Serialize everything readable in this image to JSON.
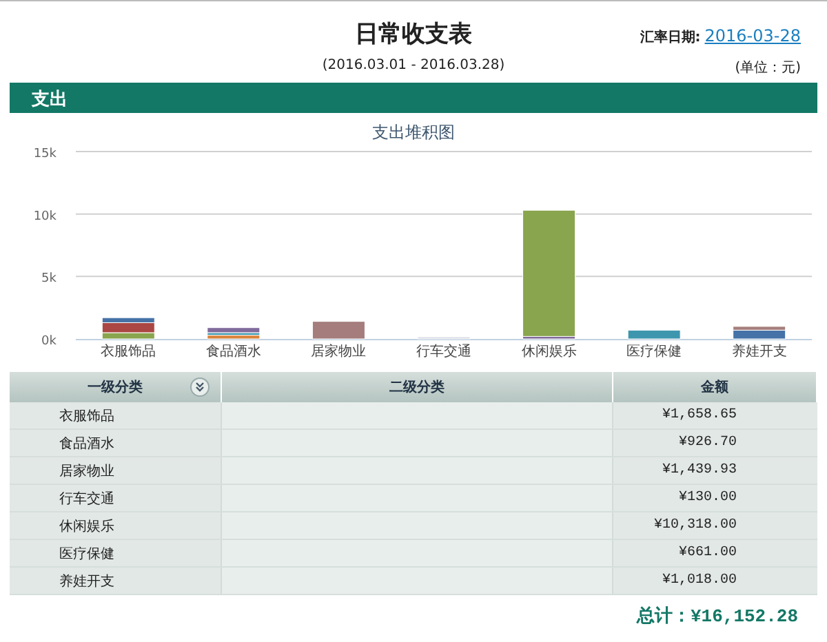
{
  "header": {
    "title": "日常收支表",
    "period": "(2016.03.01 - 2016.03.28)",
    "rate_label": "汇率日期:",
    "rate_date": "2016-03-28",
    "unit": "(单位：元)"
  },
  "section": {
    "title": "支出"
  },
  "chart_data": {
    "type": "bar",
    "stacked": true,
    "title": "支出堆积图",
    "categories": [
      "衣服饰品",
      "食品酒水",
      "居家物业",
      "行车交通",
      "休闲娱乐",
      "医疗保健",
      "养娃开支"
    ],
    "ylim": [
      0,
      15000
    ],
    "yticks": [
      {
        "value": 0,
        "label": "0k"
      },
      {
        "value": 5000,
        "label": "5k"
      },
      {
        "value": 10000,
        "label": "10k"
      },
      {
        "value": 15000,
        "label": "15k"
      }
    ],
    "series": [
      {
        "color": "#db843d",
        "values": [
          null,
          300,
          null,
          null,
          null,
          null,
          null
        ]
      },
      {
        "color": "#3d96ae",
        "values": [
          null,
          200,
          null,
          null,
          null,
          700,
          null
        ]
      },
      {
        "color": "#80699b",
        "values": [
          null,
          400,
          null,
          null,
          200,
          null,
          null
        ]
      },
      {
        "color": "#89a54e",
        "values": [
          500,
          null,
          null,
          null,
          10100,
          null,
          null
        ]
      },
      {
        "color": "#aa4643",
        "values": [
          800,
          null,
          null,
          null,
          null,
          null,
          null
        ]
      },
      {
        "color": "#4572a7",
        "values": [
          400,
          null,
          null,
          null,
          null,
          null,
          700
        ]
      },
      {
        "color": "#a47d7c",
        "values": [
          null,
          null,
          1400,
          null,
          null,
          null,
          300
        ]
      },
      {
        "color": "#d8dde6",
        "values": [
          null,
          null,
          null,
          100,
          null,
          null,
          null
        ]
      }
    ]
  },
  "table": {
    "columns": [
      "一级分类",
      "二级分类",
      "金额"
    ],
    "rows": [
      {
        "category": "衣服饰品",
        "amount": "¥1,658.65"
      },
      {
        "category": "食品酒水",
        "amount": "¥926.70"
      },
      {
        "category": "居家物业",
        "amount": "¥1,439.93"
      },
      {
        "category": "行车交通",
        "amount": "¥130.00"
      },
      {
        "category": "休闲娱乐",
        "amount": "¥10,318.00"
      },
      {
        "category": "医疗保健",
        "amount": "¥661.00"
      },
      {
        "category": "养娃开支",
        "amount": "¥1,018.00"
      }
    ]
  },
  "total": "总计：¥16,152.28"
}
